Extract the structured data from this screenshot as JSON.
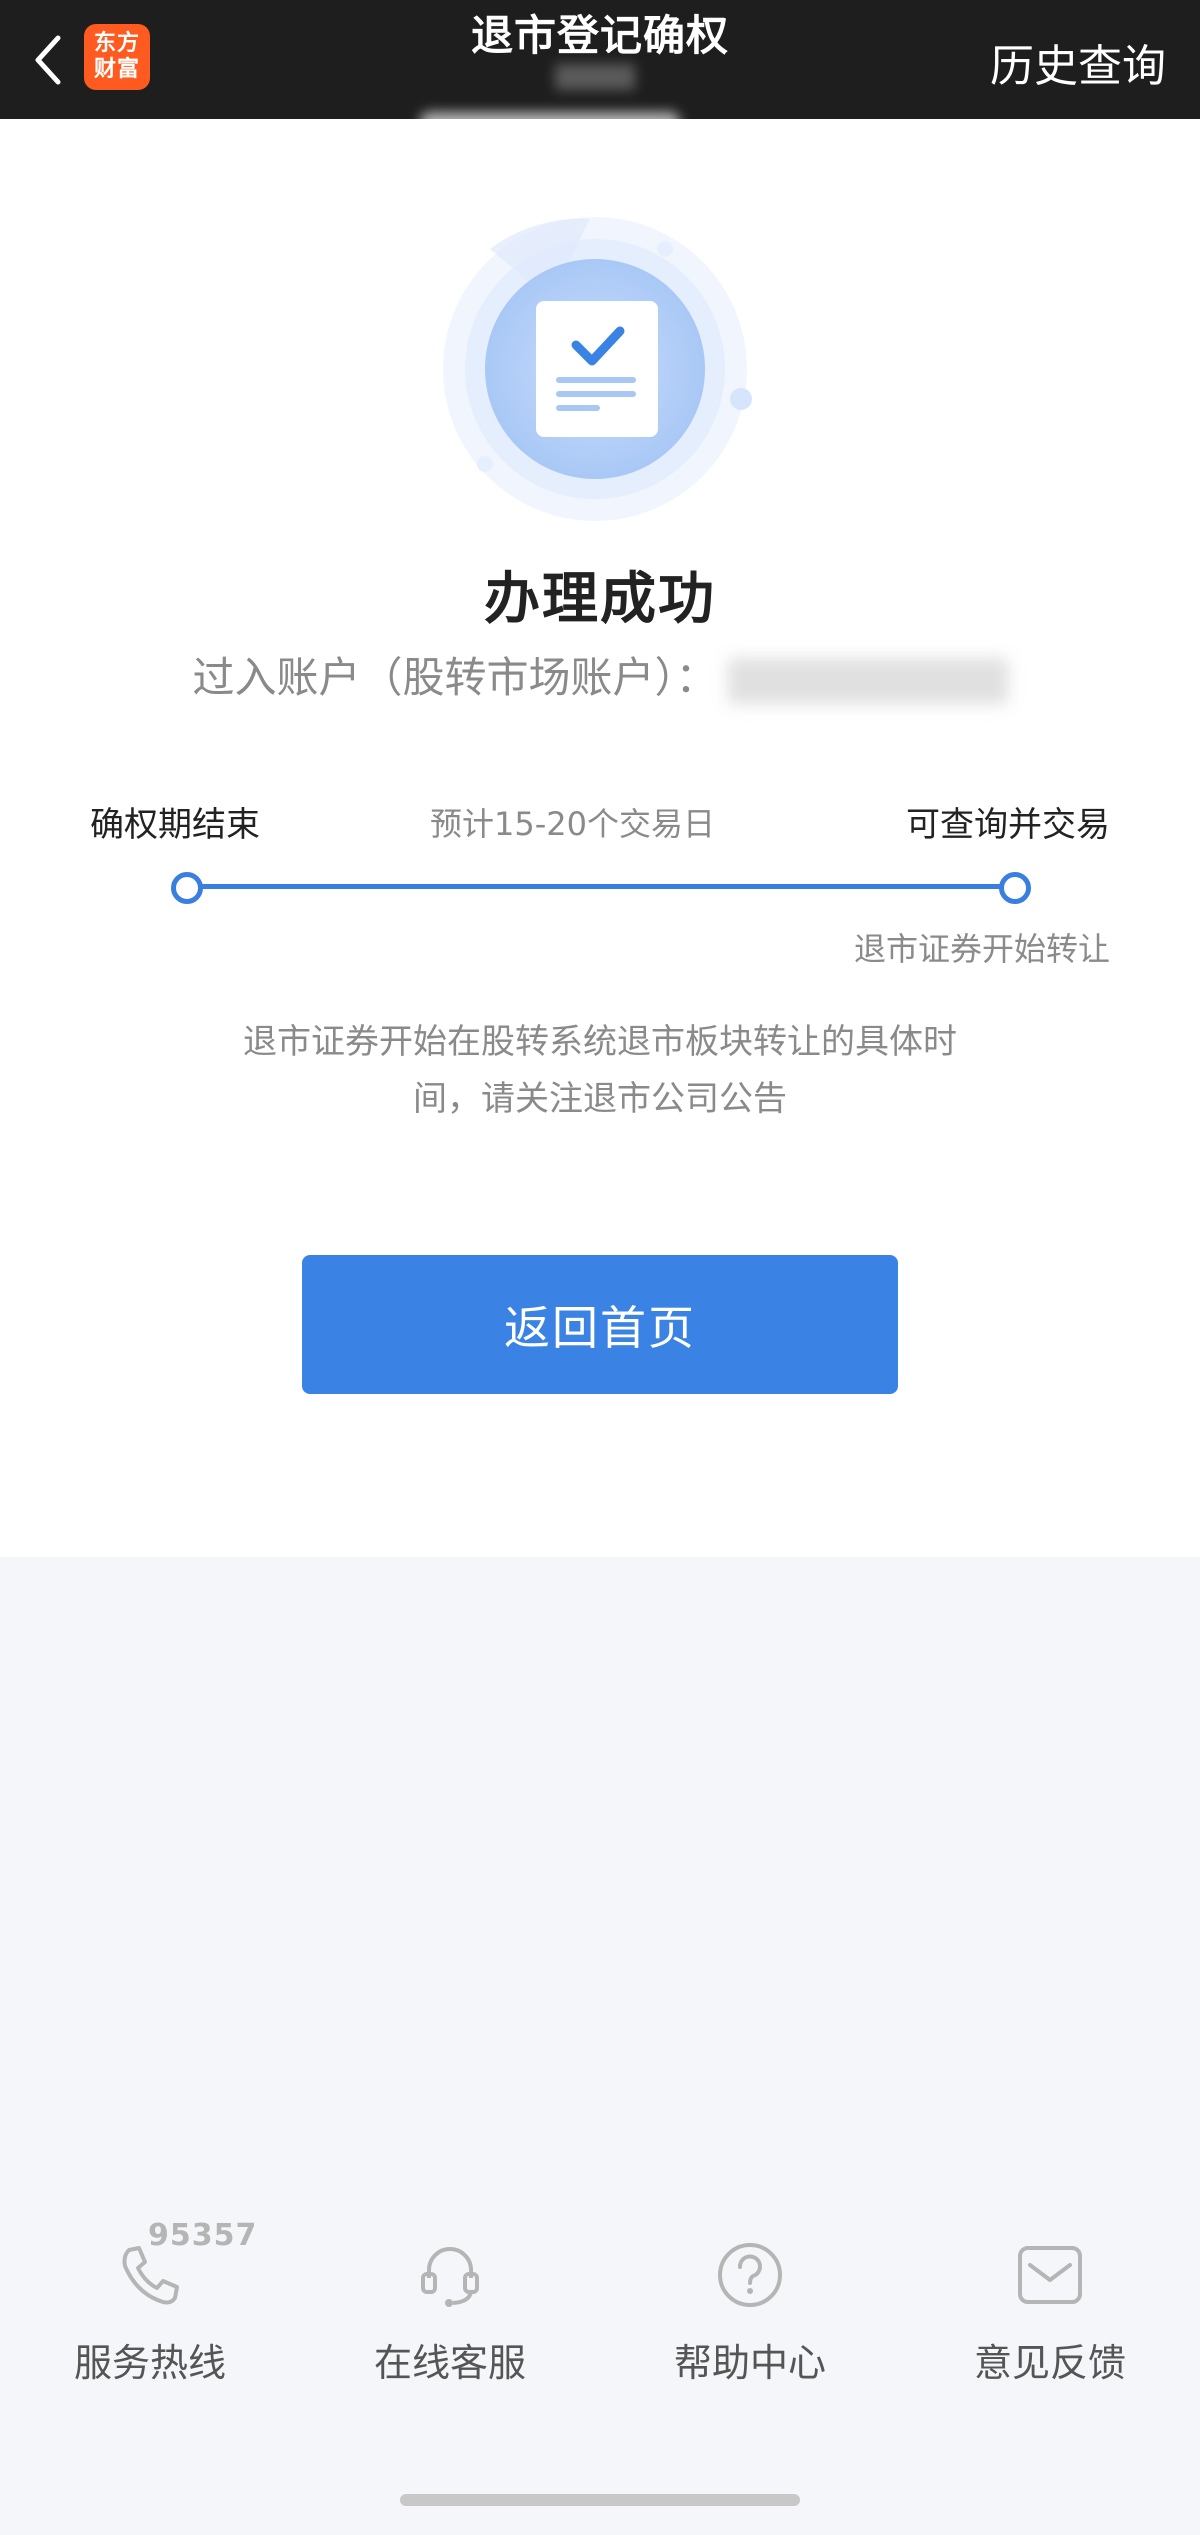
{
  "header": {
    "title": "退市登记确权",
    "history_label": "历史查询",
    "logo_line1": "东方",
    "logo_line2": "财富"
  },
  "result": {
    "status_title": "办理成功",
    "account_label": "过入账户（股转市场账户）："
  },
  "timeline": {
    "left_label": "确权期结束",
    "middle_label": "预计15-20个交易日",
    "right_label": "可查询并交易",
    "right_sub_label": "退市证券开始转让"
  },
  "note": "退市证券开始在股转系统退市板块转让的具体时间，请关注退市公司公告",
  "home_button_label": "返回首页",
  "services": [
    {
      "label": "服务热线",
      "icon": "phone-icon",
      "number": "95357"
    },
    {
      "label": "在线客服",
      "icon": "headset-icon"
    },
    {
      "label": "帮助中心",
      "icon": "help-icon"
    },
    {
      "label": "意见反馈",
      "icon": "feedback-icon"
    }
  ],
  "colors": {
    "accent": "#3a83e4",
    "topbar": "#1e1e1e",
    "logo": "#ff5a1f"
  }
}
